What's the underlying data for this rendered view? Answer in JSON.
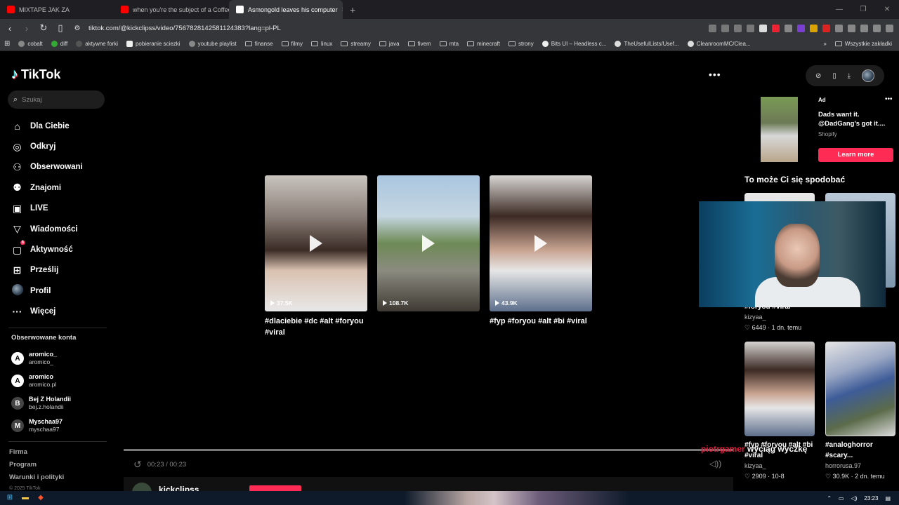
{
  "browser": {
    "tabs": [
      {
        "title": "MIXTAPE JAK ZA",
        "favicon_color": "#ff0000"
      },
      {
        "title": "when you're the subject of a Coffeez",
        "favicon_color": "#ff0000"
      },
      {
        "title": "Asmongold leaves his computer",
        "favicon_color": "#111111"
      }
    ],
    "url": "tiktok.com/@kickclipss/video/7567828142581124383?lang=pl-PL",
    "bookmarks": [
      "cobalt",
      "diff",
      "aktywne forki",
      "pobieranie sciezki",
      "youtube playlist",
      "finanse",
      "filmy",
      "linux",
      "streamy",
      "java",
      "fivem",
      "mta",
      "minecraft",
      "strony",
      "Bits UI – Headless c...",
      "TheUsefulLists/Usef...",
      "CleanroomMC/Clea..."
    ],
    "all_bookmarks": "Wszystkie zakładki"
  },
  "sidebar": {
    "logo": "TikTok",
    "search_placeholder": "Szukaj",
    "menu": [
      {
        "label": "Dla Ciebie",
        "icon": "home-icon",
        "glyph": "⌂"
      },
      {
        "label": "Odkryj",
        "icon": "compass-icon",
        "glyph": "◎"
      },
      {
        "label": "Obserwowani",
        "icon": "following-icon",
        "glyph": "⚇"
      },
      {
        "label": "Znajomi",
        "icon": "friends-icon",
        "glyph": "⚉"
      },
      {
        "label": "LIVE",
        "icon": "live-icon",
        "glyph": "▣"
      },
      {
        "label": "Wiadomości",
        "icon": "messages-icon",
        "glyph": "▽"
      },
      {
        "label": "Aktywność",
        "icon": "activity-icon",
        "glyph": "▢",
        "badge": "8"
      },
      {
        "label": "Prześlij",
        "icon": "upload-icon",
        "glyph": "⊞"
      },
      {
        "label": "Profil",
        "icon": "profile-icon",
        "glyph": ""
      },
      {
        "label": "Więcej",
        "icon": "more-icon",
        "glyph": "···"
      }
    ],
    "followed_title": "Obserwowane konta",
    "followed": [
      {
        "name": "aromico_",
        "handle": "aromico_",
        "initial": "A"
      },
      {
        "name": "aromico",
        "handle": "aromico.pl",
        "initial": "A"
      },
      {
        "name": "Bej Z Holandii",
        "handle": "bej.z.holandii",
        "initial": "B"
      },
      {
        "name": "Myschaa97",
        "handle": "myschaa97",
        "initial": "M"
      }
    ],
    "footer": [
      "Firma",
      "Program",
      "Warunki i polityki"
    ],
    "copyright": "© 2025 TikTok"
  },
  "main": {
    "thumbnails": [
      {
        "views": "37.5K",
        "caption": "#dlaciebie #dc #alt #foryou #viral"
      },
      {
        "views": "108.7K",
        "caption": ""
      },
      {
        "views": "43.9K",
        "caption": "#fyp #foryou #alt #bi #viral"
      }
    ],
    "time": "00:23 / 00:23",
    "author": "kickclipss"
  },
  "ad": {
    "label": "Ad",
    "text": "Dads want it. @DadGang's got it....",
    "brand": "Shopify",
    "button": "Learn more"
  },
  "recommended": {
    "title": "To może Ci się spodobać",
    "items": [
      {
        "tags": "#foryou #viral",
        "user": "kizyaa_",
        "likes": "6449",
        "age": "1 dn. temu"
      },
      {
        "tags": "#fyp #foryou #alt #bi #viral",
        "user": "kizyaa_",
        "likes": "2909",
        "age": "10-8"
      },
      {
        "tags": "#analoghorror #scary...",
        "user": "horrorusa.97",
        "likes": "30.9K",
        "age": "2 dn. temu"
      }
    ]
  },
  "overlay": {
    "red": "piotrgamer",
    "white": "wyciąg wyczkę"
  },
  "taskbar": {
    "time": "23:23"
  }
}
